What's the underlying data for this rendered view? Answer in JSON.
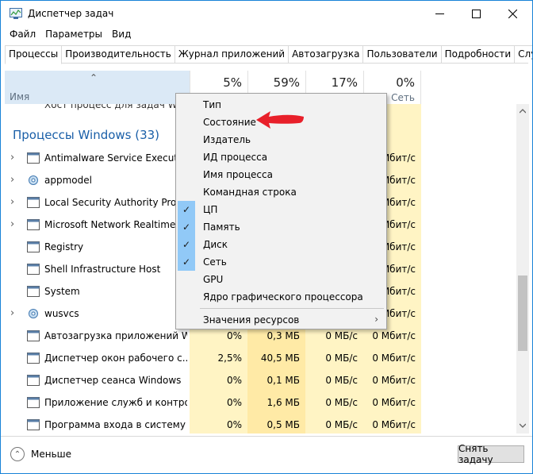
{
  "window": {
    "title": "Диспетчер задач"
  },
  "menu": [
    "Файл",
    "Параметры",
    "Вид"
  ],
  "tabs": [
    "Процессы",
    "Производительность",
    "Журнал приложений",
    "Автозагрузка",
    "Пользователи",
    "Подробности",
    "Службы"
  ],
  "header": {
    "name_label": "Имя",
    "cpu_pct": "5%",
    "mem_pct": "59%",
    "disk_pct": "17%",
    "net_pct": "0%",
    "net_label": "Сеть"
  },
  "partial_row": "Хост процесс для задач Windows",
  "group": "Процессы Windows (33)",
  "rows": [
    {
      "name": "Antimalware Service Executable",
      "expand": true,
      "icon": "window-icon",
      "net": "Мбит/с"
    },
    {
      "name": "appmodel",
      "expand": true,
      "icon": "gear-icon",
      "net": "Мбит/с"
    },
    {
      "name": "Local Security Authority Process",
      "expand": true,
      "icon": "window-icon",
      "net": "Мбит/с"
    },
    {
      "name": "Microsoft Network Realtime Inspection",
      "expand": true,
      "icon": "window-icon",
      "net": "Мбит/с"
    },
    {
      "name": "Registry",
      "expand": false,
      "icon": "window-icon",
      "net": "Мбит/с"
    },
    {
      "name": "Shell Infrastructure Host",
      "expand": false,
      "icon": "window-icon",
      "net": "Мбит/с"
    },
    {
      "name": "System",
      "expand": false,
      "icon": "window-icon",
      "net": "Мбит/с"
    },
    {
      "name": "wusvcs",
      "expand": true,
      "icon": "gear-icon",
      "net": "Мбит/с"
    },
    {
      "name": "Автозагрузка приложений Wi...",
      "expand": false,
      "icon": "window-icon",
      "cpu": "0%",
      "mem": "0,3 МБ",
      "disk": "0 МБ/с",
      "net": "0 Мбит/с"
    },
    {
      "name": "Диспетчер окон рабочего с...",
      "expand": false,
      "icon": "window-icon",
      "cpu": "2,5%",
      "mem": "40,5 МБ",
      "disk": "0 МБ/с",
      "net": "0 Мбит/с"
    },
    {
      "name": "Диспетчер сеанса  Windows",
      "expand": false,
      "icon": "window-icon",
      "cpu": "0%",
      "mem": "0,1 МБ",
      "disk": "0 МБ/с",
      "net": "0 Мбит/с"
    },
    {
      "name": "Приложение служб и контро...",
      "expand": false,
      "icon": "window-icon",
      "cpu": "0%",
      "mem": "1,6 МБ",
      "disk": "0 МБ/с",
      "net": "0 Мбит/с"
    },
    {
      "name": "Программа входа в систему ...",
      "expand": false,
      "icon": "window-icon",
      "cpu": "0%",
      "mem": "0,5 МБ",
      "disk": "0 МБ/с",
      "net": "0 Мбит/с"
    }
  ],
  "context_menu": [
    {
      "label": "Тип",
      "checked": false
    },
    {
      "label": "Состояние",
      "checked": false
    },
    {
      "label": "Издатель",
      "checked": false
    },
    {
      "label": "ИД процесса",
      "checked": false
    },
    {
      "label": "Имя процесса",
      "checked": false
    },
    {
      "label": "Командная строка",
      "checked": false
    },
    {
      "label": "ЦП",
      "checked": true
    },
    {
      "label": "Память",
      "checked": true
    },
    {
      "label": "Диск",
      "checked": true
    },
    {
      "label": "Сеть",
      "checked": true
    },
    {
      "label": "GPU",
      "checked": false
    },
    {
      "label": "Ядро графического процессора",
      "checked": false
    }
  ],
  "context_menu_extra": {
    "label": "Значения ресурсов",
    "arrow": "›"
  },
  "footer": {
    "less_label": "Меньше",
    "end_task_label": "Снять задачу"
  },
  "colors": {
    "accent": "#1883d7",
    "header_sel": "#dbe9f6",
    "heat_light": "#fff4c4",
    "heat_mid": "#ffe8a3",
    "check_bg": "#91c9f7",
    "arrow": "#e8202a"
  }
}
